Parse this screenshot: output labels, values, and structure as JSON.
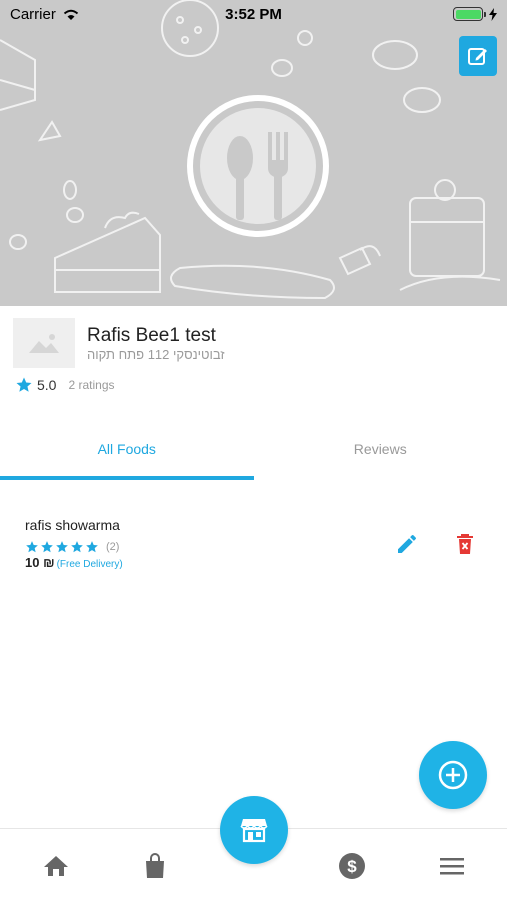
{
  "status_bar": {
    "carrier": "Carrier",
    "time": "3:52 PM"
  },
  "store": {
    "name": "Rafis Bee1 test",
    "address": "זבוטינסקי 112 פתח תקוה",
    "rating": "5.0",
    "ratings_count": "2 ratings"
  },
  "tabs": [
    {
      "label": "All Foods",
      "active": true
    },
    {
      "label": "Reviews",
      "active": false
    }
  ],
  "foods": [
    {
      "name": "rafis showarma",
      "stars": 5,
      "review_count": "(2)",
      "price": "10 ₪",
      "delivery": "(Free Delivery)"
    }
  ],
  "icons": {
    "edit_cover": "edit-square-icon",
    "placeholder": "image-placeholder-icon",
    "star": "star-icon",
    "food_edit": "pencil-icon",
    "food_delete": "delete-icon",
    "fab": "add-circle-icon",
    "nav": [
      "home-icon",
      "shopping-bag-icon",
      "store-icon",
      "dollar-icon",
      "menu-icon"
    ]
  },
  "colors": {
    "accent": "#1fa8e0",
    "delete": "#e53935",
    "banner": "#c9c9c9",
    "nav_icon": "#666666"
  }
}
